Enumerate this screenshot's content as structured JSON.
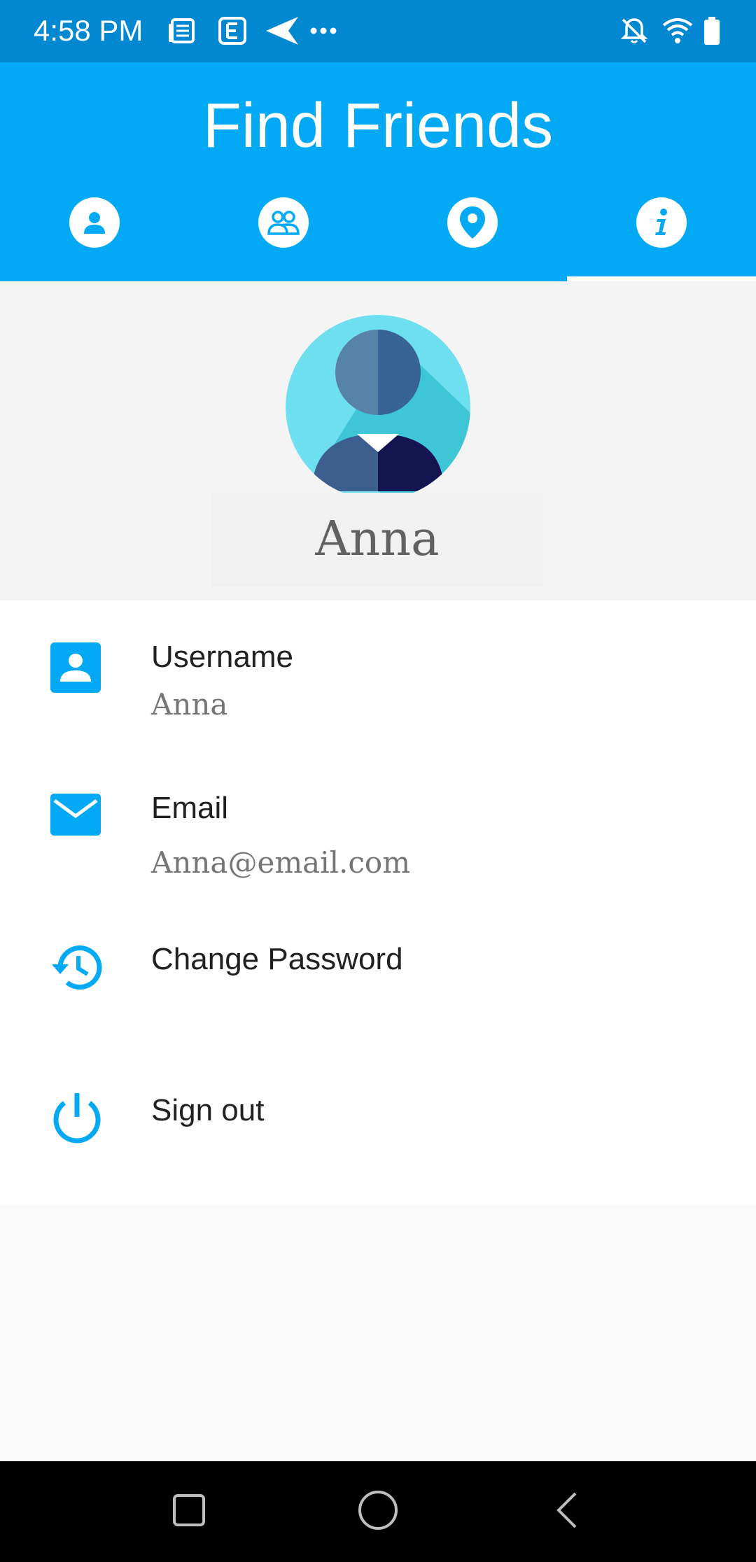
{
  "status_bar": {
    "time": "4:58 PM",
    "icons": [
      "news-icon",
      "document-e-icon",
      "send-icon",
      "more-dots-icon",
      "bell-off-icon",
      "wifi-icon",
      "battery-icon"
    ]
  },
  "app_bar": {
    "title": "Find Friends",
    "tabs": [
      {
        "name": "profile",
        "icon": "person-icon"
      },
      {
        "name": "friends",
        "icon": "group-icon"
      },
      {
        "name": "location",
        "icon": "location-pin-icon"
      },
      {
        "name": "info",
        "icon": "info-icon",
        "selected": true
      }
    ]
  },
  "profile": {
    "name": "Anna"
  },
  "details": {
    "username": {
      "label": "Username",
      "value": "Anna"
    },
    "email": {
      "label": "Email",
      "value": "Anna@email.com"
    },
    "change_password": {
      "label": "Change Password"
    },
    "sign_out": {
      "label": "Sign out"
    }
  },
  "colors": {
    "status_bar": "#0288d1",
    "primary": "#03a9f4",
    "text_primary": "#212121",
    "text_secondary": "#757575"
  },
  "nav_bar": {
    "buttons": [
      "recents-icon",
      "home-icon",
      "back-icon"
    ]
  }
}
